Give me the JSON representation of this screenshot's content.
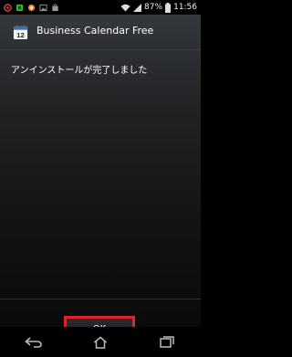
{
  "status_bar": {
    "battery_percent": "87%",
    "time": "11:56",
    "left_icons": [
      "notification-icon-red",
      "notification-icon-green",
      "notification-icon-orange",
      "image-icon",
      "bag-icon"
    ],
    "right_icons": [
      "wifi-icon",
      "signal-icon",
      "battery-icon"
    ]
  },
  "dialog": {
    "app_title": "Business Calendar Free",
    "app_icon_day": "12",
    "message": "アンインストールが完了しました",
    "ok_label": "OK",
    "highlight_color": "#e0242e"
  },
  "nav_bar": {
    "buttons": [
      "back-icon",
      "home-icon",
      "recent-apps-icon"
    ]
  }
}
